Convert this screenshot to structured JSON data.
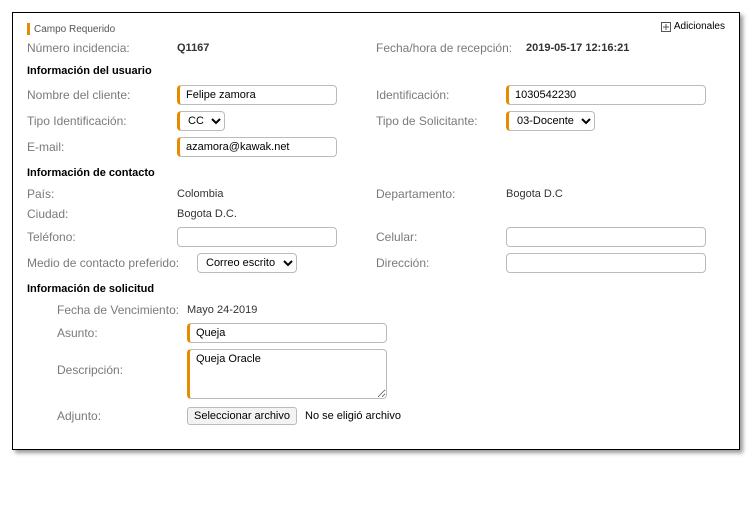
{
  "legend": "Campo Requerido",
  "adicionales": "Adicionales",
  "top": {
    "num_label": "Número incidencia:",
    "num_value": "Q1167",
    "fecha_label": "Fecha/hora de recepción:",
    "fecha_value": "2019-05-17 12:16:21"
  },
  "sec_usuario": "Información del usuario",
  "usuario": {
    "nombre_label": "Nombre del cliente:",
    "nombre_value": "Felipe zamora",
    "ident_label": "Identificación:",
    "ident_value": "1030542230",
    "tipo_id_label": "Tipo Identificación:",
    "tipo_id_sel": "CC",
    "tipo_sol_label": "Tipo de Solicitante:",
    "tipo_sol_sel": "03-Docente",
    "email_label": "E-mail:",
    "email_value": "azamora@kawak.net"
  },
  "sec_contacto": "Información de contacto",
  "contacto": {
    "pais_label": "País:",
    "pais_value": "Colombia",
    "dep_label": "Departamento:",
    "dep_value": "Bogota D.C",
    "ciudad_label": "Ciudad:",
    "ciudad_value": "Bogota D.C.",
    "tel_label": "Teléfono:",
    "tel_value": "",
    "cel_label": "Celular:",
    "cel_value": "",
    "medio_label": "Medio de contacto preferido:",
    "medio_sel": "Correo escrito",
    "dir_label": "Dirección:",
    "dir_value": ""
  },
  "sec_solicitud": "Información de solicitud",
  "solicitud": {
    "fv_label": "Fecha de Vencimiento:",
    "fv_value": "Mayo 24-2019",
    "asunto_label": "Asunto:",
    "asunto_value": "Queja",
    "desc_label": "Descripción:",
    "desc_value": "Queja Oracle",
    "adj_label": "Adjunto:",
    "adj_button": "Seleccionar archivo",
    "adj_status": "No se eligió archivo"
  }
}
